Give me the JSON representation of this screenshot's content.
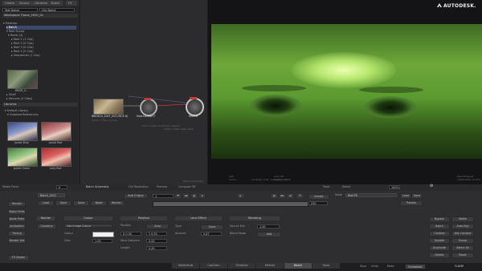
{
  "top_tabs": [
    "Create",
    "Source",
    "Librarian",
    "Batch",
    "FX"
  ],
  "brand": "AUTODESK.",
  "workspace": {
    "search_left": "Text Name",
    "search_right": "Clip Name",
    "title": "Workspace Flame_2020_01",
    "tree": [
      "Desktop",
      "Batch",
      "Reel Group",
      "Reels (4)",
      "Reel 1 (1 Clip)",
      "Reel 2 (0 Clip)",
      "Reel 3 (0 Clip)",
      "Reel 4 (0 Clip)",
      "Sequences (1 Clip)"
    ],
    "thumb_caption": "BRIDE_0...",
    "tree2": [
      "Shelf",
      "Sources (4 Clips)"
    ],
    "libraries_title": "Libraries",
    "libraries": [
      "Default Library",
      "Grabbed References"
    ],
    "grid_thumbs": [
      "Jacket Blue",
      "Jacket Red",
      "Jacket Green",
      "Lady Red"
    ]
  },
  "schematic": {
    "source_label": "BRIDE20_2007_003 (MOV 8)",
    "source_sub": "1920 x 1080 x 24 fps",
    "matte_label": "MatchGrade77",
    "matte_sub": "1920 x 1080 23.976 fps 10bit/P",
    "action_label": "Reel78",
    "action_sub": "1920 x 1080 24fps 10bit",
    "corner_text": "Batch Schematic"
  },
  "viewer": {
    "info_left": [
      "Left",
      "Action"
    ],
    "info_mid": [
      "Contrast: 0.00",
      "Contrast: 1.00"
    ],
    "info_right": [
      "Lum Off",
      "Gamma: 1.00"
    ],
    "corner_right": [
      "Reel78 Result",
      "1920x1080 23.976"
    ]
  },
  "toolbar": {
    "media_panel": "Media Panel",
    "frame": "0",
    "batch_label": "Batch Schematic",
    "full_res": "Full Resolution",
    "preview": "Preview",
    "compare": "Compare Off",
    "tools": "Tools",
    "select": "Select",
    "zoom": "100%"
  },
  "controls": {
    "clip_name": "Batch_2021",
    "prefix": "Load",
    "save": "Save",
    "save_as": "Save",
    "node": "Node",
    "render": "Render",
    "add_output": "Add Output",
    "iterate": "Iterate",
    "start_frame": "1",
    "end_frame": "230",
    "node_name": "Reel78",
    "load": "Load",
    "save2": "Save",
    "presets": "Presets",
    "left_buttons": [
      "Render",
      "Batch Prefs",
      "Node Prefs",
      "Animation",
      "Timing",
      "Render List"
    ],
    "fx_nodes": "FX Nodes",
    "scope": "Render",
    "combine": "Combine",
    "colour_hdr": "Colour",
    "colour_mode": "Use Image Colour",
    "colour_label": "Colour",
    "gain_label": "Gain",
    "gain_value": "1.00",
    "position_hdr": "Position",
    "position_label": "Position",
    "position_mode": "Auto",
    "pos_x": "X 0.50",
    "pos_y": "Y 0.50",
    "near_label": "Near Distance",
    "near_value": "0.00",
    "length_label": "Length",
    "length_value": "0.20",
    "lens_hdr": "Lens Effect",
    "type_label": "Type",
    "type_value": "Glare",
    "amount_label": "Amount",
    "amount_value": "0.67",
    "blend_hdr": "Blending",
    "source_mix_label": "Source Mix",
    "source_mix_value": "1.00",
    "blend_mode_label": "Blend Mode",
    "blend_mode_value": "Add",
    "right_col1": [
      "Bypass",
      "Batch",
      "Context",
      "Update",
      "Duplicate",
      "Delete"
    ],
    "right_col2": [
      "Matte",
      "Auto Key",
      "Ally Context",
      "Group",
      "Select All",
      "Reset"
    ]
  },
  "bottom_tabs": [
    "MediaHub",
    "Conform",
    "Timeline",
    "Effects",
    "Batch",
    "Tools"
  ],
  "bottom_status": {
    "save": "Save",
    "undo": "Undo",
    "redo": "Redo",
    "frame": "Unmarked",
    "brand": "FLAME"
  }
}
